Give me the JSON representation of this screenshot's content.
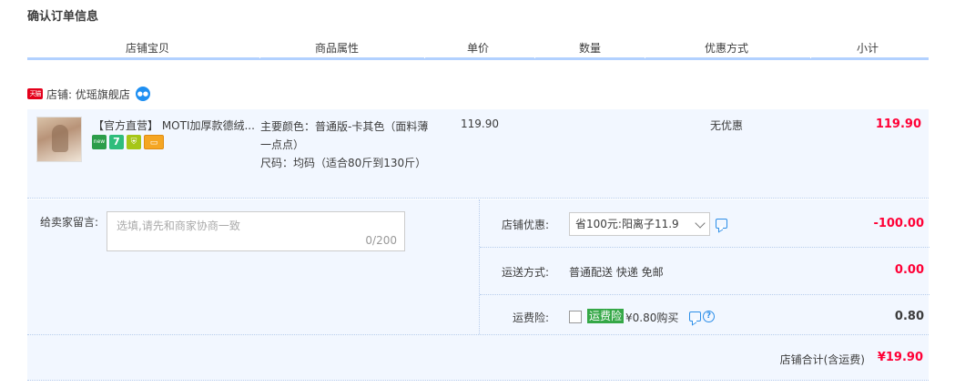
{
  "page_title": "确认订单信息",
  "columns": [
    "店铺宝贝",
    "商品属性",
    "单价",
    "数量",
    "优惠方式",
    "小计"
  ],
  "shop": {
    "badge_text": "天猫",
    "label": "店铺: 优瑶旗舰店",
    "chat_icon": "wangwang-icon"
  },
  "item": {
    "title": "【官方直营】 MOTI加厚款德绒...",
    "badges": [
      {
        "name": "new-badge-icon",
        "text": "new",
        "color": "#2c9d4a"
      },
      {
        "name": "seven-days-return-icon",
        "text": "7",
        "color": "#2ebd7c"
      },
      {
        "name": "shield-guarantee-icon",
        "text": "",
        "color": "#a6c617"
      },
      {
        "name": "credit-card-icon",
        "text": "",
        "color": "#f5a623"
      }
    ],
    "attr_color": "主要颜色：普通版-卡其色（面料薄一点点）",
    "attr_size": "尺码：均码（适合80斤到130斤）",
    "unit_price": "119.90",
    "discount": "无优惠",
    "subtotal": "119.90"
  },
  "message": {
    "label": "给卖家留言:",
    "placeholder": "选填,请先和商家协商一致",
    "count": "0/200"
  },
  "shop_discount": {
    "label": "店铺优惠:",
    "selected": "省100元:阳离子11.9",
    "value": "-100.00"
  },
  "shipping": {
    "label": "运送方式:",
    "method": "普通配送 快递 免邮",
    "value": "0.00"
  },
  "insurance": {
    "label": "运费险:",
    "badge": "运费险",
    "text": "¥0.80购买",
    "value": "0.80",
    "help": "?"
  },
  "total": {
    "label": "店铺合计(含运费)",
    "value": "¥19.90"
  },
  "colors": {
    "accent_red": "#ff0036",
    "row_bg": "#f2f7ff",
    "header_line": "#b2d1ff"
  }
}
